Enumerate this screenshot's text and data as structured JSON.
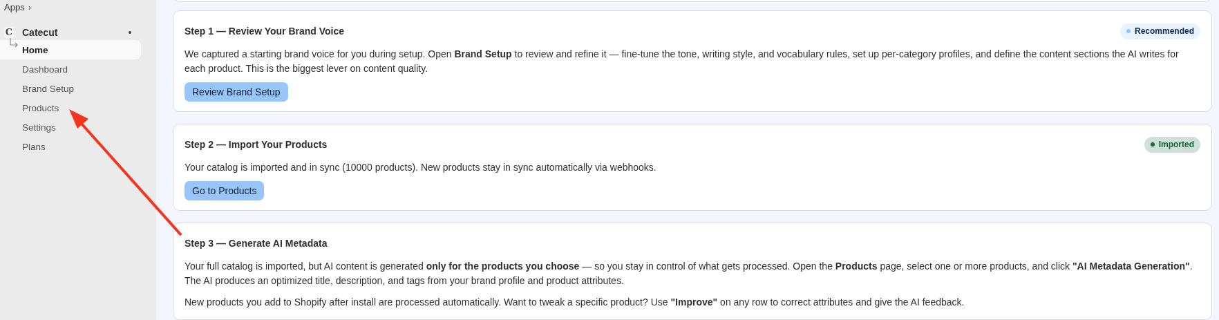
{
  "breadcrumb": {
    "label": "Apps",
    "chevron": "›"
  },
  "sidebar": {
    "app": {
      "name": "Catecut",
      "logo": "C"
    },
    "items": [
      {
        "label": "Home",
        "selected": true,
        "kind": "child"
      },
      {
        "label": "Dashboard",
        "selected": false,
        "kind": "link"
      },
      {
        "label": "Brand Setup",
        "selected": false,
        "kind": "link"
      },
      {
        "label": "Products",
        "selected": false,
        "kind": "link"
      },
      {
        "label": "Settings",
        "selected": false,
        "kind": "link"
      },
      {
        "label": "Plans",
        "selected": false,
        "kind": "link"
      }
    ]
  },
  "steps": [
    {
      "title": "Step 1 — Review Your Brand Voice",
      "badge": {
        "label": "Recommended",
        "color": "#93c5fd"
      },
      "paragraphs": [
        "We captured a starting brand voice for you during setup. Open **Brand Setup** to review and refine it — fine-tune the tone, writing style, and vocabulary rules, set up per-category profiles, and define the content sections the AI writes for each product. This is the biggest lever on content quality."
      ],
      "button": "Review Brand Setup"
    },
    {
      "title": "Step 2 — Import Your Products",
      "badge": {
        "label": "Imported",
        "color": "#16633f"
      },
      "paragraphs": [
        "Your catalog is imported and in sync (10000 products). New products stay in sync automatically via webhooks."
      ],
      "button": "Go to Products"
    },
    {
      "title": "Step 3 — Generate AI Metadata",
      "paragraphs": [
        "Your full catalog is imported, but AI content is generated **only for the products you choose** — so you stay in control of what gets processed. Open the **Products** page, select one or more products, and click **\"AI Metadata Generation\"**. The AI produces an optimized title, description, and tags from your brand profile and product attributes.",
        "New products you add to Shopify after install are processed automatically. Want to tweak a specific product? Use **\"Improve\"** on any row to correct attributes and give the AI feedback."
      ]
    }
  ],
  "annotation": {
    "kind": "arrow"
  }
}
